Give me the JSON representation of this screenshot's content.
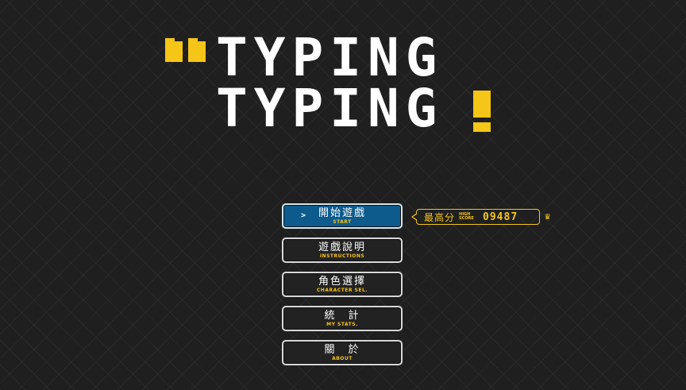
{
  "title": {
    "line1": "TYPING",
    "line2": "TYPING",
    "accent_color": "#f5c518"
  },
  "menu": {
    "cursor_glyph": ">",
    "items": [
      {
        "label": "開始遊戲",
        "sub": "START",
        "active": true
      },
      {
        "label": "遊戲說明",
        "sub": "INSTRUCTIONS",
        "active": false
      },
      {
        "label": "角色選擇",
        "sub": "CHARACTER SEL.",
        "active": false
      },
      {
        "label": "統　計",
        "sub": "MY STATS.",
        "active": false
      },
      {
        "label": "關　於",
        "sub": "ABOUT",
        "active": false
      }
    ]
  },
  "high_score": {
    "label": "最高分",
    "sub_line1": "HIGH",
    "sub_line2": "SCORE",
    "value": "09487",
    "icon": "crown-icon"
  }
}
